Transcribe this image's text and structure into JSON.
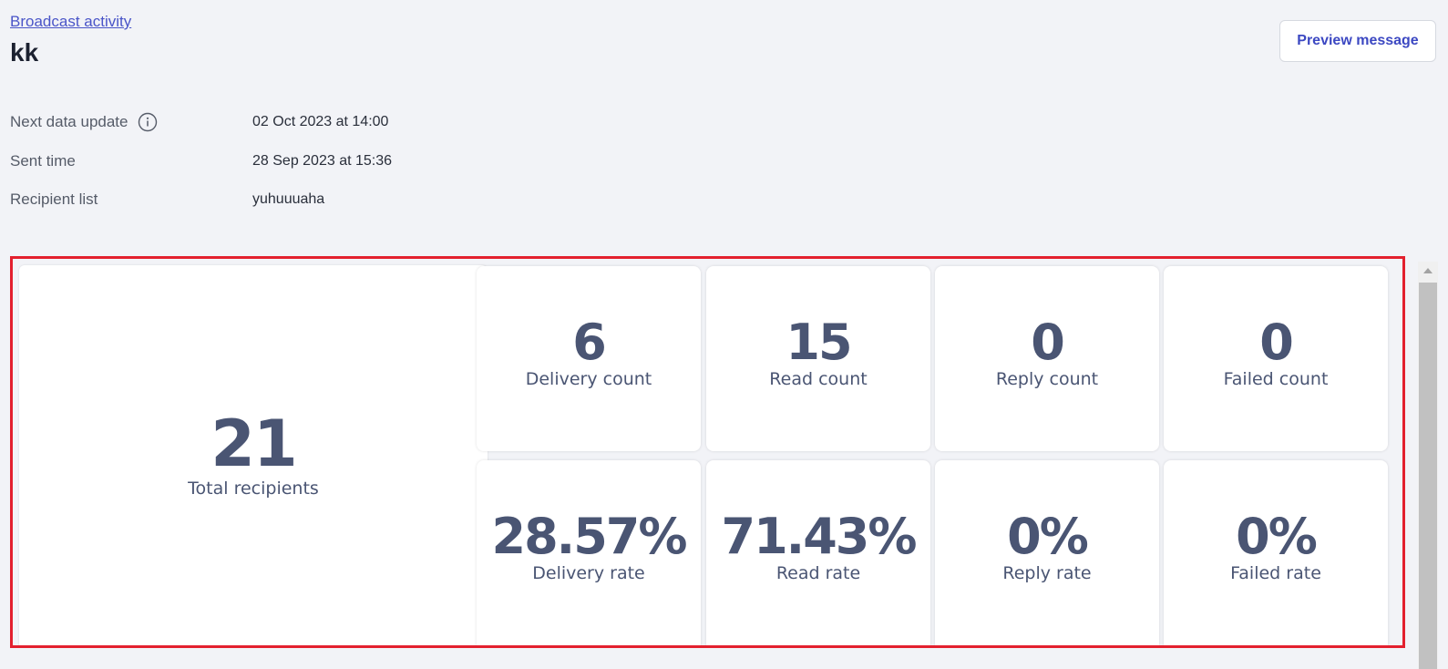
{
  "breadcrumb": "Broadcast activity",
  "title": "kk",
  "preview_button": "Preview message",
  "info": {
    "next_update_label": "Next data update",
    "next_update_value": "02 Oct 2023 at 14:00",
    "sent_time_label": "Sent time",
    "sent_time_value": "28 Sep 2023 at 15:36",
    "recipient_list_label": "Recipient list",
    "recipient_list_value": "yuhuuuaha"
  },
  "stats": {
    "total": {
      "value": "21",
      "label": "Total recipients"
    },
    "counts": [
      {
        "value": "6",
        "label": "Delivery count"
      },
      {
        "value": "15",
        "label": "Read count"
      },
      {
        "value": "0",
        "label": "Reply count"
      },
      {
        "value": "0",
        "label": "Failed count"
      }
    ],
    "rates": [
      {
        "value": "28.57%",
        "label": "Delivery rate"
      },
      {
        "value": "71.43%",
        "label": "Read rate"
      },
      {
        "value": "0%",
        "label": "Reply rate"
      },
      {
        "value": "0%",
        "label": "Failed rate"
      }
    ]
  },
  "colors": {
    "highlight_border": "#e3202e",
    "link": "#4a55c8",
    "stat_text": "#4a5573"
  }
}
